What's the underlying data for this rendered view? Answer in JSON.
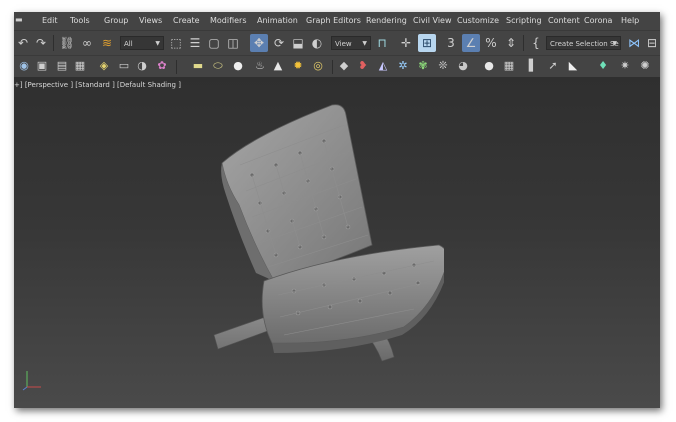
{
  "menubar": {
    "items": [
      "Edit",
      "Tools",
      "Group",
      "Views",
      "Create",
      "Modifiers",
      "Animation",
      "Graph Editors",
      "Rendering",
      "Civil View",
      "Customize",
      "Scripting",
      "Content",
      "Corona",
      "Help"
    ]
  },
  "toolbar1": {
    "selection_filter": "All",
    "reference_coord": "View",
    "named_selection": "Create Selection Se",
    "icons": [
      "undo-icon",
      "redo-icon",
      "link-icon",
      "unlink-icon",
      "bind-space-warp-icon",
      "select-object-icon",
      "select-by-name-icon",
      "rect-selection-icon",
      "window-crossing-icon",
      "select-move-icon",
      "select-rotate-icon",
      "select-scale-icon",
      "select-place-icon",
      "pivot-icon",
      "selection-lock-icon",
      "keyboard-shortcut-icon",
      "snaps-3d-icon",
      "angle-snap-icon",
      "percent-snap-icon",
      "spinner-snap-icon",
      "edit-named-selection-icon",
      "mirror-icon",
      "align-icon"
    ]
  },
  "toolbar2": {
    "icons": [
      "material-editor-icon",
      "render-setup-icon",
      "rendered-frame-icon",
      "render-icon",
      "layer-icon",
      "scene-explorer-icon",
      "ribbon-icon",
      "shape-box-icon",
      "shape-cylinder-icon",
      "shape-sphere-icon",
      "shape-teapot-icon",
      "shape-cone-icon",
      "light-sun-icon",
      "light-omni-icon",
      "modifier-icon",
      "particle-icon",
      "hair-icon",
      "cloth-icon",
      "physics-icon",
      "scatter-icon",
      "sphere-ball-icon",
      "grid-icon",
      "viewport-icon",
      "cursor-icon",
      "lamp-icon",
      "gear-icon",
      "sun-icon"
    ]
  },
  "viewport": {
    "label": "+] [Perspective ] [Standard ] [Default Shading ]"
  },
  "colors": {
    "ui_bg": "#444444",
    "viewport_top": "#2f2f2f",
    "viewport_bottom": "#4a4a4a",
    "active_tool": "#5b7fb1",
    "model_gray": "#8c8c8c"
  }
}
